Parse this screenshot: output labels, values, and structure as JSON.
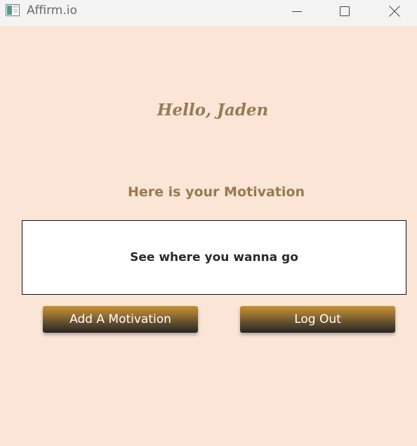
{
  "window": {
    "title": "Affirm.io",
    "icon": "app-window-icon",
    "controls": {
      "minimize_icon": "minimize-icon",
      "maximize_icon": "maximize-icon",
      "close_icon": "close-icon"
    }
  },
  "main": {
    "greeting": "Hello, Jaden",
    "subheading": "Here is your Motivation",
    "motivation_text": "See where you wanna go",
    "buttons": {
      "add_label": "Add A Motivation",
      "logout_label": "Log Out"
    }
  },
  "colors": {
    "background": "#fae5d6",
    "titlebar": "#f3f3f3",
    "heading_text": "#957c55",
    "button_top": "#c69130",
    "button_bottom": "#262626",
    "motivation_box": "#ffffff"
  }
}
